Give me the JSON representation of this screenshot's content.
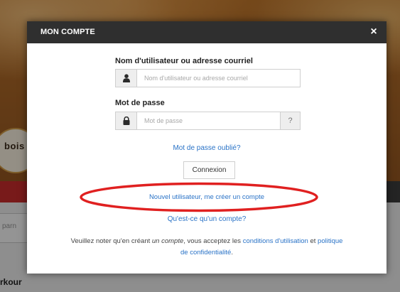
{
  "background": {
    "logo_text": "bois",
    "search_partial": "parn",
    "bottom_partial": "rkour"
  },
  "modal": {
    "title": "MON COMPTE",
    "close_symbol": "×",
    "username_label": "Nom d'utilisateur ou adresse courriel",
    "username_placeholder": "Nom d'utilisateur ou adresse courriel",
    "password_label": "Mot de passe",
    "password_placeholder": "Mot de passe",
    "password_help": "?",
    "forgot_password": "Mot de passe oublié?",
    "connect_button": "Connexion",
    "new_user_link": "Nouvel utilisateur, me créer un compte",
    "what_is_account": "Qu'est-ce qu'un compte?",
    "notice": {
      "part1": "Veuillez noter qu'en créant ",
      "em": "un compte",
      "part2": ", vous acceptez les ",
      "link1": "conditions d'utilisation",
      "part3": " et ",
      "link2": "politique de confidentialité",
      "part4": "."
    }
  },
  "icons": {
    "username": "user-icon",
    "password": "lock-icon",
    "close": "close-icon"
  },
  "colors": {
    "header_bg": "#2f2f2f",
    "link": "#2a73c7",
    "highlight": "#e02020",
    "banner_red": "#cf2d2d"
  }
}
